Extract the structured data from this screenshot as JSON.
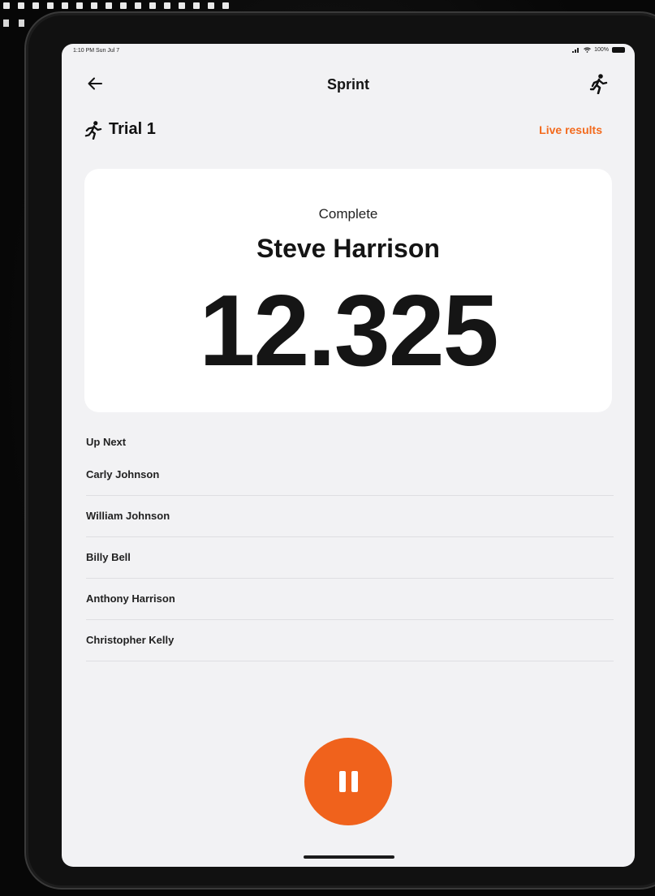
{
  "status_bar": {
    "time": "1:10 PM  Sun Jul 7",
    "battery": "100%"
  },
  "nav": {
    "back_icon": "arrow-left-icon",
    "title": "Sprint",
    "runner_icon": "runner-icon"
  },
  "trial": {
    "icon": "runner-icon",
    "title": "Trial 1",
    "live_results": "Live results"
  },
  "result": {
    "status": "Complete",
    "athlete": "Steve Harrison",
    "time": "12.325"
  },
  "up_next": {
    "heading": "Up Next",
    "athletes": [
      "Carly Johnson",
      "William Johnson",
      "Billy Bell",
      "Anthony Harrison",
      "Christopher Kelly"
    ]
  },
  "controls": {
    "pause_icon": "pause-icon"
  },
  "colors": {
    "accent": "#f0621c",
    "live_link": "#f36a1d",
    "screen_bg": "#f2f2f4",
    "card_bg": "#ffffff"
  }
}
